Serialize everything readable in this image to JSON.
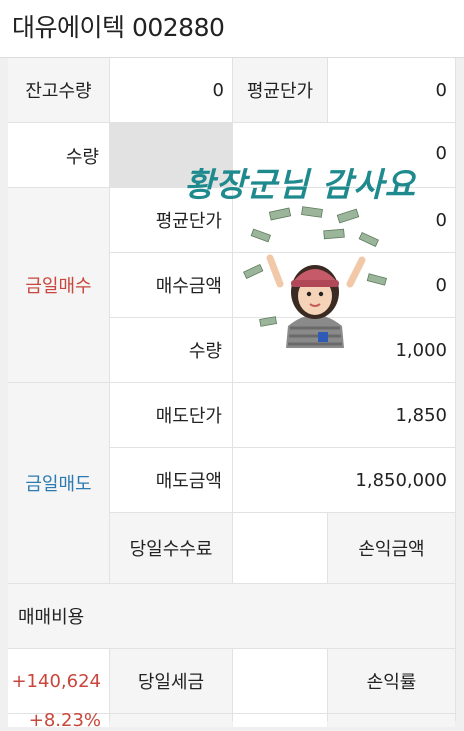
{
  "header": {
    "title": "대유에이텍 002880"
  },
  "holding": {
    "qty_label": "잔고수량",
    "qty_value": "0",
    "avg_label": "평균단가",
    "avg_value": "0"
  },
  "buy": {
    "section_label": "금일매수",
    "qty_label": "수량",
    "qty_value": "0",
    "avg_label": "평균단가",
    "avg_value": "0",
    "amount_label": "매수금액",
    "amount_value": "0"
  },
  "sell": {
    "section_label": "금일매도",
    "qty_label": "수량",
    "qty_value": "1,000",
    "price_label": "매도단가",
    "price_value": "1,850",
    "amount_label": "매도금액",
    "amount_value": "1,850,000"
  },
  "fees": {
    "trade_cost_label": "매매비용",
    "commission_label": "당일수수료",
    "tax_label": "당일세금"
  },
  "profit": {
    "amount_label": "손익금액",
    "amount_value": "+140,624",
    "rate_label": "손익률",
    "rate_value": "+8.23%"
  },
  "overlay": {
    "caption": "황장군님 감사요",
    "sticker_icon": "money-rain-avatar-icon"
  },
  "colors": {
    "buy": "#c8463c",
    "sell": "#2c7bb0",
    "profit": "#c8463c",
    "overlay_text": "#1f8a8e"
  }
}
